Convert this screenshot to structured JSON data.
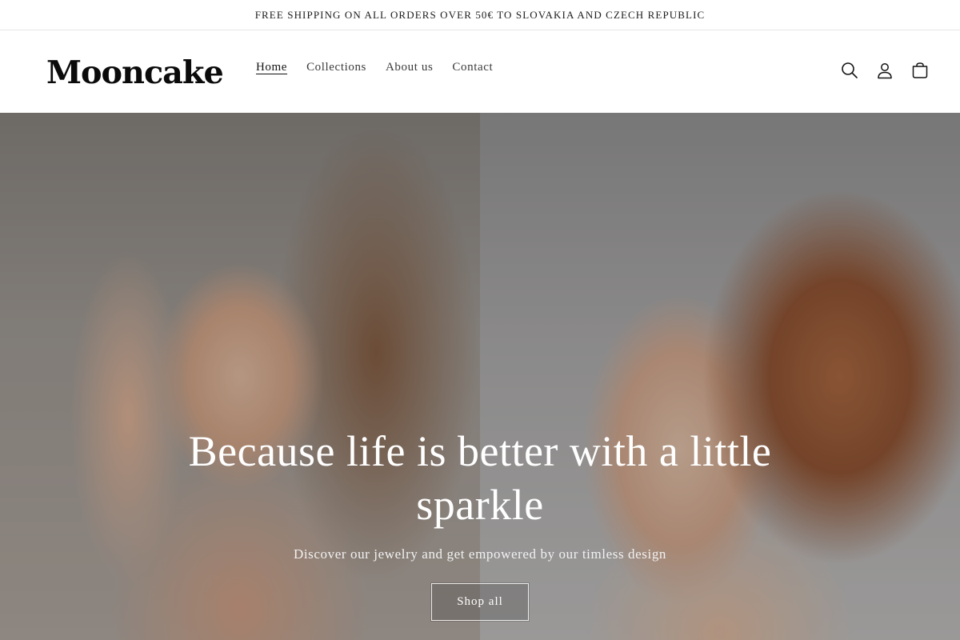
{
  "announcement": {
    "text": "FREE SHIPPING ON ALL ORDERS OVER 50€ TO SLOVAKIA AND CZECH REPUBLIC"
  },
  "header": {
    "logo": "Mooncake",
    "nav": [
      {
        "label": "Home",
        "active": true
      },
      {
        "label": "Collections",
        "active": false
      },
      {
        "label": "About us",
        "active": false
      },
      {
        "label": "Contact",
        "active": false
      }
    ],
    "icons": [
      "search-icon",
      "account-icon",
      "cart-icon"
    ]
  },
  "hero": {
    "title": "Because life is better with a little sparkle",
    "subtitle": "Discover our jewelry and get empowered by our timless design",
    "button_label": "Shop all"
  }
}
